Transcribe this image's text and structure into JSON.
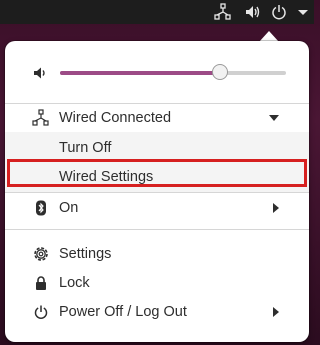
{
  "top_bar": {
    "icons": [
      "network-wired-icon",
      "volume-icon",
      "power-icon",
      "chevron-down-icon"
    ]
  },
  "volume": {
    "icon": "volume-icon",
    "level": 0.71,
    "accent_color": "#9c4b86"
  },
  "network": {
    "icon": "network-wired-icon",
    "label": "Wired Connected",
    "submenu": {
      "turn_off": "Turn Off",
      "wired_settings": "Wired Settings"
    }
  },
  "bluetooth": {
    "icon": "bluetooth-icon",
    "label": "On"
  },
  "actions": {
    "settings": {
      "icon": "gear-icon",
      "label": "Settings"
    },
    "lock": {
      "icon": "lock-icon",
      "label": "Lock"
    },
    "power": {
      "icon": "power-icon",
      "label": "Power Off / Log Out"
    }
  },
  "colors": {
    "highlight": "#d62020",
    "menu_bg": "#ffffff",
    "submenu_bg": "#f4f4f4"
  }
}
